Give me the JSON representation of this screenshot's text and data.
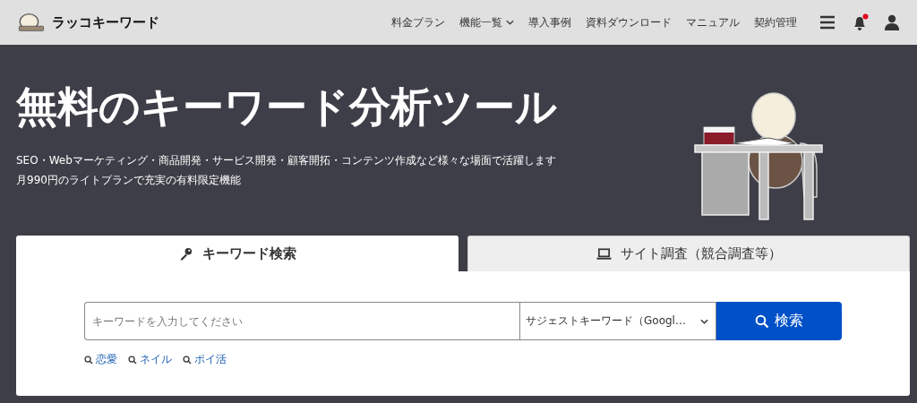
{
  "header": {
    "logo_text": "ラッコキーワード",
    "nav": [
      {
        "label": "料金プラン",
        "dropdown": false
      },
      {
        "label": "機能一覧",
        "dropdown": true
      },
      {
        "label": "導入事例",
        "dropdown": false
      },
      {
        "label": "資料ダウンロード",
        "dropdown": false
      },
      {
        "label": "マニュアル",
        "dropdown": false
      },
      {
        "label": "契約管理",
        "dropdown": false
      }
    ],
    "notification_unread": true
  },
  "hero": {
    "title": "無料のキーワード分析ツール",
    "lines": [
      "SEO・Webマーケティング・商品開発・サービス開発・顧客開拓・コンテンツ作成など様々な場面で活躍します",
      "月990円のライトプランで充実の有料限定機能"
    ]
  },
  "tabs": [
    {
      "label": "キーワード検索",
      "kind": "key",
      "selected": true
    },
    {
      "label": "サイト調査（競合調査等）",
      "kind": "laptop",
      "selected": false
    }
  ],
  "search": {
    "placeholder": "キーワードを入力してください",
    "mode": "サジェストキーワード（Googl…",
    "button": "検索"
  },
  "suggestions": [
    "恋愛",
    "ネイル",
    "ポイ活"
  ]
}
